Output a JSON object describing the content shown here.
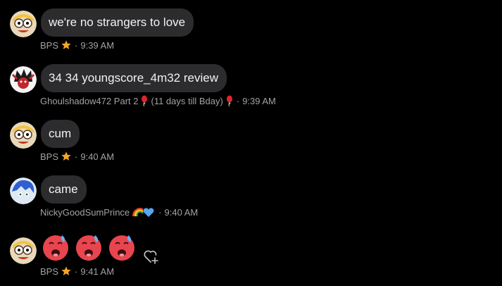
{
  "messages": [
    {
      "text": "we're no strangers to love",
      "author": "BPS",
      "badge": "star-icon",
      "separator": "·",
      "time": "9:39 AM"
    },
    {
      "text": "34 34 youngscore_4m32 review",
      "author": "Ghoulshadow472 Part 2",
      "badge_before": "balloon-icon",
      "status": "(11 days till Bday)",
      "badge_after": "balloon-icon",
      "separator": "·",
      "time": "9:39 AM"
    },
    {
      "text": "cum",
      "author": "BPS",
      "badge": "star-icon",
      "separator": "·",
      "time": "9:40 AM"
    },
    {
      "text": "came",
      "author": "NickyGoodSumPrince",
      "badge": "rainbow-heart-icon",
      "separator": "·",
      "time": "9:40 AM"
    },
    {
      "emojis": [
        "hot-face-emoji",
        "hot-face-emoji",
        "hot-face-emoji"
      ],
      "author": "BPS",
      "badge": "star-icon",
      "separator": "·",
      "time": "9:41 AM",
      "action": "add-reaction-icon"
    }
  ],
  "colors": {
    "background": "#000000",
    "bubble": "#2c2c2e",
    "text": "#f2f2f2",
    "meta": "#a2a2a6",
    "star": "#f5a623",
    "balloon": "#e0252b"
  }
}
